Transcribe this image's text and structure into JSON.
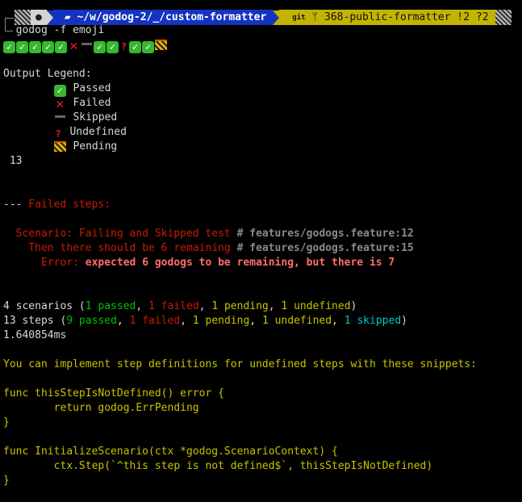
{
  "prompt": {
    "apple_icon": "apple-icon",
    "folder_icon": "folder-icon",
    "path": "~/w/godog-2/_/custom-formatter",
    "git_label": "git",
    "branch_icon": "git-branch-icon",
    "branch": "368-public-formatter !2 ?2",
    "colors": {
      "dir": "#1433c0",
      "git": "#c2b400"
    }
  },
  "command": "godog -f emoji",
  "progress": [
    "passed",
    "passed",
    "passed",
    "passed",
    "passed",
    "failed",
    "skipped",
    "passed",
    "passed",
    "undefined",
    "passed",
    "passed",
    "pending"
  ],
  "legend": {
    "title": "Output Legend:",
    "items": [
      {
        "status": "passed",
        "label": "Passed"
      },
      {
        "status": "failed",
        "label": "Failed"
      },
      {
        "status": "skipped",
        "label": "Skipped"
      },
      {
        "status": "undefined",
        "label": "Undefined"
      },
      {
        "status": "pending",
        "label": "Pending"
      }
    ]
  },
  "step_count": " 13",
  "failed": {
    "header_dash": "---",
    "header": " Failed steps:",
    "scenario": "  Scenario: Failing and Skipped test",
    "scenario_ref": " # features/godogs.feature:12",
    "step": "    Then there should be 6 remaining",
    "step_ref": " # features/godogs.feature:15",
    "error_label": "      Error: ",
    "error_msg": "expected 6 godogs to be remaining, but there is 7"
  },
  "summary": {
    "scenarios_prefix": "4 scenarios (",
    "sc_passed": "1 passed",
    "sc_failed": "1 failed",
    "sc_pending": "1 pending",
    "sc_undefined": "1 undefined",
    "steps_prefix": "13 steps (",
    "st_passed": "9 passed",
    "st_failed": "1 failed",
    "st_pending": "1 pending",
    "st_undefined": "1 undefined",
    "st_skipped": "1 skipped",
    "sep": ", ",
    "close": ")",
    "duration": "1.640854ms"
  },
  "snippets": {
    "intro": "You can implement step definitions for undefined steps with these snippets:",
    "lines": [
      "func thisStepIsNotDefined() error {",
      "        return godog.ErrPending",
      "}",
      "",
      "func InitializeScenario(ctx *godog.ScenarioContext) {",
      "        ctx.Step(`^this step is not defined$`, thisStepIsNotDefined)",
      "}"
    ]
  }
}
